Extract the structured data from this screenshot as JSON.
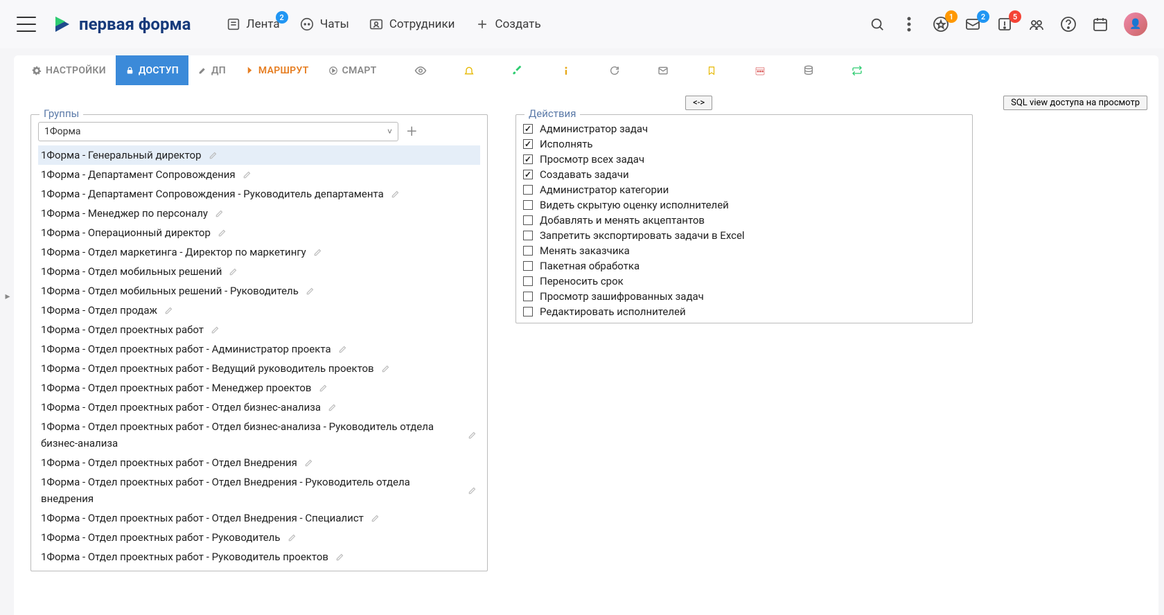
{
  "logo_text": "первая форма",
  "nav": {
    "feed": "Лента",
    "feed_badge": "2",
    "chats": "Чаты",
    "employees": "Сотрудники",
    "create": "Создать"
  },
  "header_badges": {
    "star": "1",
    "inbox": "2",
    "alert": "5"
  },
  "tabs": {
    "settings": "НАСТРОЙКИ",
    "access": "ДОСТУП",
    "dp": "ДП",
    "route": "МАРШРУТ",
    "smart": "СМАРТ"
  },
  "toolbar": {
    "swap": "<->",
    "sql": "SQL view доступа на просмотр"
  },
  "groups": {
    "legend": "Группы",
    "selected": "1Форма",
    "items": [
      "1Форма - Генеральный директор",
      "1Форма - Департамент Сопровождения",
      "1Форма - Департамент Сопровождения - Руководитель департамента",
      "1Форма - Менеджер по персоналу",
      "1Форма - Операционный директор",
      "1Форма - Отдел маркетинга - Директор по маркетингу",
      "1Форма - Отдел мобильных решений",
      "1Форма - Отдел мобильных решений - Руководитель",
      "1Форма - Отдел продаж",
      "1Форма - Отдел проектных работ",
      "1Форма - Отдел проектных работ - Администратор проекта",
      "1Форма - Отдел проектных работ - Ведущий руководитель проектов",
      "1Форма - Отдел проектных работ - Менеджер проектов",
      "1Форма - Отдел проектных работ - Отдел бизнес-анализа",
      "1Форма - Отдел проектных работ - Отдел бизнес-анализа - Руководитель отдела бизнес-анализа",
      "1Форма - Отдел проектных работ - Отдел Внедрения",
      "1Форма - Отдел проектных работ - Отдел Внедрения - Руководитель отдела внедрения",
      "1Форма - Отдел проектных работ - Отдел Внедрения - Специалист",
      "1Форма - Отдел проектных работ - Руководитель",
      "1Форма - Отдел проектных работ - Руководитель проектов"
    ]
  },
  "actions": {
    "legend": "Действия",
    "items": [
      {
        "label": "Администратор задач",
        "checked": true
      },
      {
        "label": "Исполнять",
        "checked": true
      },
      {
        "label": "Просмотр всех задач",
        "checked": true
      },
      {
        "label": "Создавать задачи",
        "checked": true
      },
      {
        "label": "Администратор категории",
        "checked": false
      },
      {
        "label": "Видеть скрытую оценку исполнителей",
        "checked": false
      },
      {
        "label": "Добавлять и менять акцептантов",
        "checked": false
      },
      {
        "label": "Запретить экспортировать задачи в Excel",
        "checked": false
      },
      {
        "label": "Менять заказчика",
        "checked": false
      },
      {
        "label": "Пакетная обработка",
        "checked": false
      },
      {
        "label": "Переносить срок",
        "checked": false
      },
      {
        "label": "Просмотр зашифрованных задач",
        "checked": false
      },
      {
        "label": "Редактировать исполнителей",
        "checked": false
      }
    ]
  }
}
